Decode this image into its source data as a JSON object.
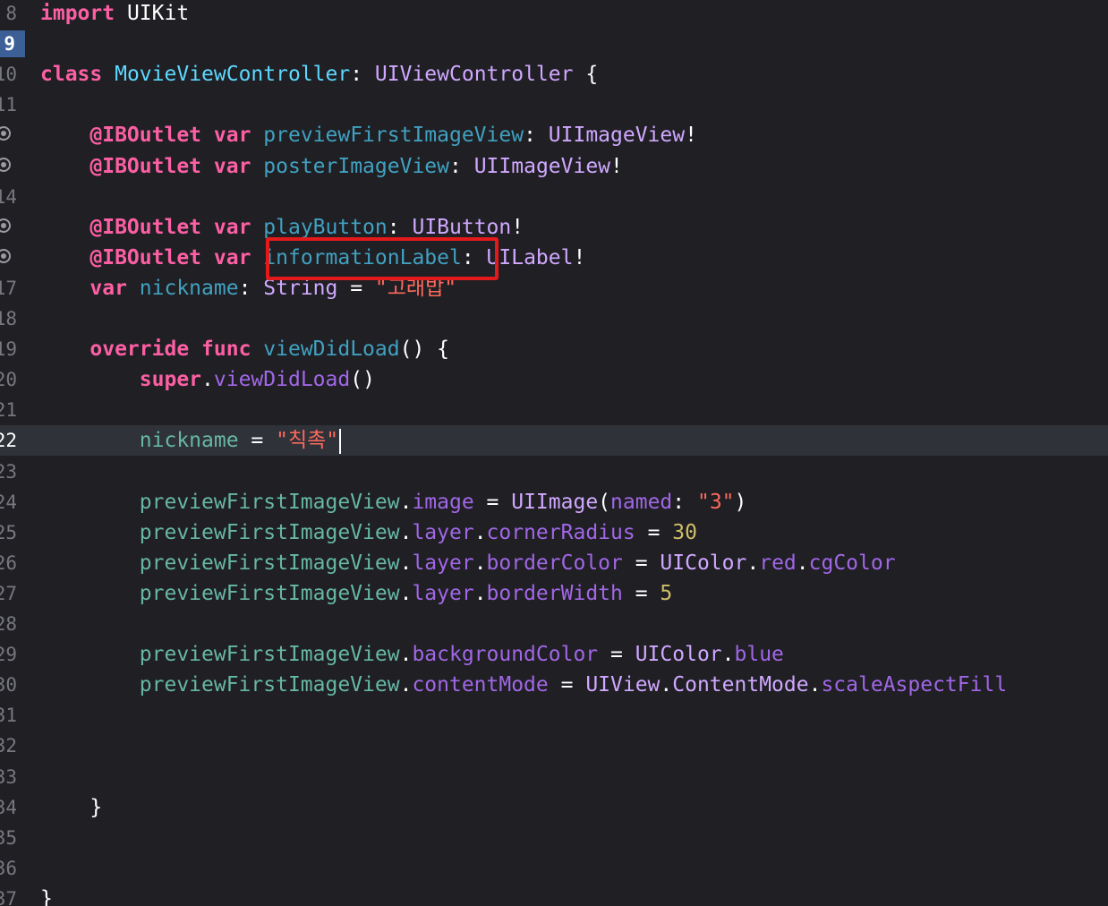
{
  "editor": {
    "lines": [
      {
        "num": "8",
        "tokens": [
          {
            "t": "import",
            "c": "kw"
          },
          {
            "t": " UIKit",
            "c": "pln"
          }
        ]
      },
      {
        "num": "9",
        "breakpoint": true,
        "tokens": []
      },
      {
        "num": "10",
        "tokens": [
          {
            "t": "class",
            "c": "kw"
          },
          {
            "t": " ",
            "c": "pln"
          },
          {
            "t": "MovieViewController",
            "c": "decl"
          },
          {
            "t": ": ",
            "c": "pln"
          },
          {
            "t": "UIViewController",
            "c": "typ"
          },
          {
            "t": " {",
            "c": "pln"
          }
        ]
      },
      {
        "num": "11",
        "tokens": []
      },
      {
        "num": "12",
        "outlet": true,
        "tokens": [
          {
            "t": "    ",
            "c": "pln"
          },
          {
            "t": "@IBOutlet",
            "c": "kw"
          },
          {
            "t": " ",
            "c": "pln"
          },
          {
            "t": "var",
            "c": "kw"
          },
          {
            "t": " ",
            "c": "pln"
          },
          {
            "t": "previewFirstImageView",
            "c": "prop"
          },
          {
            "t": ": ",
            "c": "pln"
          },
          {
            "t": "UIImageView",
            "c": "typ"
          },
          {
            "t": "!",
            "c": "pln"
          }
        ]
      },
      {
        "num": "13",
        "outlet": true,
        "tokens": [
          {
            "t": "    ",
            "c": "pln"
          },
          {
            "t": "@IBOutlet",
            "c": "kw"
          },
          {
            "t": " ",
            "c": "pln"
          },
          {
            "t": "var",
            "c": "kw"
          },
          {
            "t": " ",
            "c": "pln"
          },
          {
            "t": "posterImageView",
            "c": "prop"
          },
          {
            "t": ": ",
            "c": "pln"
          },
          {
            "t": "UIImageView",
            "c": "typ"
          },
          {
            "t": "!",
            "c": "pln"
          }
        ]
      },
      {
        "num": "14",
        "tokens": []
      },
      {
        "num": "15",
        "outlet": true,
        "tokens": [
          {
            "t": "    ",
            "c": "pln"
          },
          {
            "t": "@IBOutlet",
            "c": "kw"
          },
          {
            "t": " ",
            "c": "pln"
          },
          {
            "t": "var",
            "c": "kw"
          },
          {
            "t": " ",
            "c": "pln"
          },
          {
            "t": "playButton",
            "c": "prop"
          },
          {
            "t": ": ",
            "c": "pln"
          },
          {
            "t": "UIButton",
            "c": "typ"
          },
          {
            "t": "!",
            "c": "pln"
          }
        ]
      },
      {
        "num": "16",
        "outlet": true,
        "tokens": [
          {
            "t": "    ",
            "c": "pln"
          },
          {
            "t": "@IBOutlet",
            "c": "kw"
          },
          {
            "t": " ",
            "c": "pln"
          },
          {
            "t": "var",
            "c": "kw"
          },
          {
            "t": " ",
            "c": "pln"
          },
          {
            "t": "informationLabel",
            "c": "prop"
          },
          {
            "t": ": ",
            "c": "pln"
          },
          {
            "t": "UILabel",
            "c": "typ"
          },
          {
            "t": "!",
            "c": "pln"
          }
        ]
      },
      {
        "num": "17",
        "tokens": [
          {
            "t": "    ",
            "c": "pln"
          },
          {
            "t": "var",
            "c": "kw"
          },
          {
            "t": " ",
            "c": "pln"
          },
          {
            "t": "nickname",
            "c": "prop"
          },
          {
            "t": ": ",
            "c": "pln"
          },
          {
            "t": "String",
            "c": "typ"
          },
          {
            "t": " = ",
            "c": "pln"
          },
          {
            "t": "\"고래밥\"",
            "c": "str"
          }
        ]
      },
      {
        "num": "18",
        "tokens": []
      },
      {
        "num": "19",
        "tokens": [
          {
            "t": "    ",
            "c": "pln"
          },
          {
            "t": "override",
            "c": "kw"
          },
          {
            "t": " ",
            "c": "pln"
          },
          {
            "t": "func",
            "c": "kw"
          },
          {
            "t": " ",
            "c": "pln"
          },
          {
            "t": "viewDidLoad",
            "c": "prop"
          },
          {
            "t": "() {",
            "c": "pln"
          }
        ]
      },
      {
        "num": "20",
        "tokens": [
          {
            "t": "        ",
            "c": "pln"
          },
          {
            "t": "super",
            "c": "kw"
          },
          {
            "t": ".",
            "c": "pln"
          },
          {
            "t": "viewDidLoad",
            "c": "lm"
          },
          {
            "t": "()",
            "c": "pln"
          }
        ]
      },
      {
        "num": "21",
        "tokens": []
      },
      {
        "num": "22",
        "current": true,
        "caret": true,
        "tokens": [
          {
            "t": "        ",
            "c": "pln"
          },
          {
            "t": "nickname",
            "c": "var"
          },
          {
            "t": " = ",
            "c": "pln"
          },
          {
            "t": "\"칙촉\"",
            "c": "str"
          }
        ]
      },
      {
        "num": "23",
        "tokens": []
      },
      {
        "num": "24",
        "tokens": [
          {
            "t": "        ",
            "c": "pln"
          },
          {
            "t": "previewFirstImageView",
            "c": "var"
          },
          {
            "t": ".",
            "c": "pln"
          },
          {
            "t": "image",
            "c": "lm"
          },
          {
            "t": " = ",
            "c": "pln"
          },
          {
            "t": "UIImage",
            "c": "typ"
          },
          {
            "t": "(",
            "c": "pln"
          },
          {
            "t": "named",
            "c": "lm"
          },
          {
            "t": ": ",
            "c": "pln"
          },
          {
            "t": "\"3\"",
            "c": "str"
          },
          {
            "t": ")",
            "c": "pln"
          }
        ]
      },
      {
        "num": "25",
        "tokens": [
          {
            "t": "        ",
            "c": "pln"
          },
          {
            "t": "previewFirstImageView",
            "c": "var"
          },
          {
            "t": ".",
            "c": "pln"
          },
          {
            "t": "layer",
            "c": "lm"
          },
          {
            "t": ".",
            "c": "pln"
          },
          {
            "t": "cornerRadius",
            "c": "lm"
          },
          {
            "t": " = ",
            "c": "pln"
          },
          {
            "t": "30",
            "c": "num-lit"
          }
        ]
      },
      {
        "num": "26",
        "tokens": [
          {
            "t": "        ",
            "c": "pln"
          },
          {
            "t": "previewFirstImageView",
            "c": "var"
          },
          {
            "t": ".",
            "c": "pln"
          },
          {
            "t": "layer",
            "c": "lm"
          },
          {
            "t": ".",
            "c": "pln"
          },
          {
            "t": "borderColor",
            "c": "lm"
          },
          {
            "t": " = ",
            "c": "pln"
          },
          {
            "t": "UIColor",
            "c": "typ"
          },
          {
            "t": ".",
            "c": "pln"
          },
          {
            "t": "red",
            "c": "lm"
          },
          {
            "t": ".",
            "c": "pln"
          },
          {
            "t": "cgColor",
            "c": "lm"
          }
        ]
      },
      {
        "num": "27",
        "tokens": [
          {
            "t": "        ",
            "c": "pln"
          },
          {
            "t": "previewFirstImageView",
            "c": "var"
          },
          {
            "t": ".",
            "c": "pln"
          },
          {
            "t": "layer",
            "c": "lm"
          },
          {
            "t": ".",
            "c": "pln"
          },
          {
            "t": "borderWidth",
            "c": "lm"
          },
          {
            "t": " = ",
            "c": "pln"
          },
          {
            "t": "5",
            "c": "num-lit"
          }
        ]
      },
      {
        "num": "28",
        "tokens": []
      },
      {
        "num": "29",
        "tokens": [
          {
            "t": "        ",
            "c": "pln"
          },
          {
            "t": "previewFirstImageView",
            "c": "var"
          },
          {
            "t": ".",
            "c": "pln"
          },
          {
            "t": "backgroundColor",
            "c": "lm"
          },
          {
            "t": " = ",
            "c": "pln"
          },
          {
            "t": "UIColor",
            "c": "typ"
          },
          {
            "t": ".",
            "c": "pln"
          },
          {
            "t": "blue",
            "c": "lm"
          }
        ]
      },
      {
        "num": "30",
        "tokens": [
          {
            "t": "        ",
            "c": "pln"
          },
          {
            "t": "previewFirstImageView",
            "c": "var"
          },
          {
            "t": ".",
            "c": "pln"
          },
          {
            "t": "contentMode",
            "c": "lm"
          },
          {
            "t": " = ",
            "c": "pln"
          },
          {
            "t": "UIView",
            "c": "typ"
          },
          {
            "t": ".",
            "c": "pln"
          },
          {
            "t": "ContentMode",
            "c": "typ"
          },
          {
            "t": ".",
            "c": "pln"
          },
          {
            "t": "scaleAspectFill",
            "c": "lm"
          }
        ]
      },
      {
        "num": "31",
        "tokens": []
      },
      {
        "num": "32",
        "tokens": []
      },
      {
        "num": "33",
        "tokens": []
      },
      {
        "num": "34",
        "tokens": [
          {
            "t": "    }",
            "c": "pln"
          }
        ]
      },
      {
        "num": "35",
        "tokens": []
      },
      {
        "num": "36",
        "tokens": []
      },
      {
        "num": "37",
        "tokens": [
          {
            "t": "}",
            "c": "pln"
          }
        ]
      }
    ],
    "colors": {
      "background": "#1f1f24",
      "current_line": "#2f3239",
      "keyword": "#fc5fa3",
      "type": "#d0a8ff",
      "declaration": "#5dd8ff",
      "property": "#41a1c0",
      "variable": "#67b7a4",
      "member": "#a167e6",
      "string": "#fc6a5d",
      "number": "#d0bf69",
      "highlight_box": "#e3191c"
    }
  }
}
